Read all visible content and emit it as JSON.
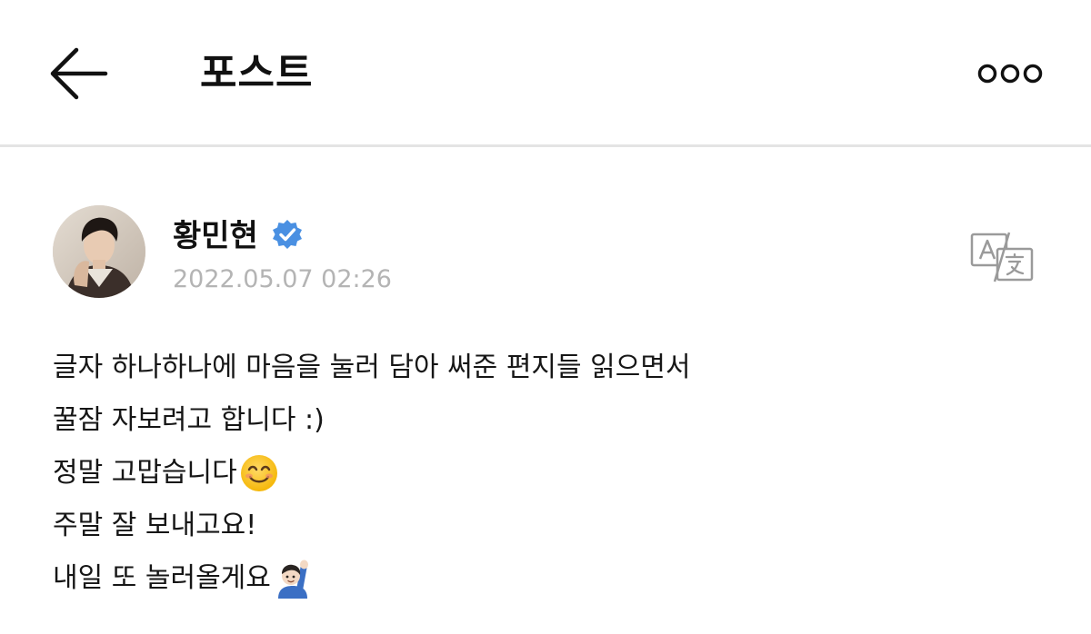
{
  "header": {
    "title": "포스트",
    "back_icon": "back-arrow-icon",
    "more_icon": "more-options-icon"
  },
  "post": {
    "author": {
      "name": "황민현",
      "verified": true,
      "timestamp": "2022.05.07 02:26"
    },
    "translate_icon": "translate-icon",
    "lines": [
      {
        "text": "글자 하나하나에 마음을 눌러 담아 써준 편지들 읽으면서"
      },
      {
        "text": "꿀잠 자보려고 합니다 :)"
      },
      {
        "text": "정말 고맙습니다",
        "emoji": "smiling-face-emoji"
      },
      {
        "text": "주말 잘 보내고요!"
      },
      {
        "text": "내일 또 놀러올게요",
        "emoji": "person-raising-hand-emoji"
      }
    ]
  },
  "colors": {
    "verified_badge": "#4a90e2",
    "timestamp": "#b4b4b4",
    "divider": "#e4e4e4",
    "text": "#161616"
  }
}
